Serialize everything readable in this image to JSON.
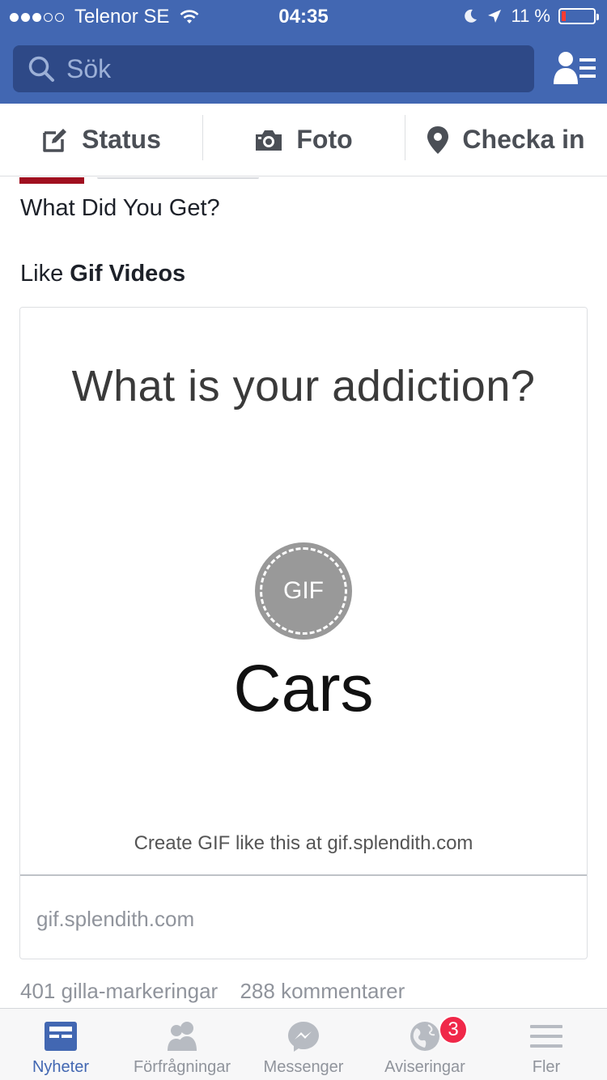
{
  "status_bar": {
    "carrier": "Telenor SE",
    "time": "04:35",
    "battery_percent": "11 %"
  },
  "search": {
    "placeholder": "Sök"
  },
  "composer": {
    "status_label": "Status",
    "photo_label": "Foto",
    "checkin_label": "Checka in"
  },
  "post": {
    "text": "What Did You Get?",
    "like_prefix": "Like",
    "page_name": "Gif Videos",
    "card": {
      "gif_title": "What is your addiction?",
      "gif_badge": "GIF",
      "gif_answer": "Cars",
      "gif_footer": "Create GIF like this at gif.splendith.com",
      "domain": "gif.splendith.com"
    },
    "likes": "401 gilla-markeringar",
    "comments": "288 kommentarer"
  },
  "tabs": [
    {
      "label": "Nyheter",
      "icon": "news-feed-icon",
      "active": true
    },
    {
      "label": "Förfrågningar",
      "icon": "friend-requests-icon"
    },
    {
      "label": "Messenger",
      "icon": "messenger-icon"
    },
    {
      "label": "Aviseringar",
      "icon": "globe-icon",
      "badge": "3"
    },
    {
      "label": "Fler",
      "icon": "hamburger-menu-icon"
    }
  ],
  "colors": {
    "brand_blue": "#4267b2",
    "search_bg": "#2e4987",
    "badge_red": "#f02849",
    "battery_red": "#ff3b30"
  }
}
